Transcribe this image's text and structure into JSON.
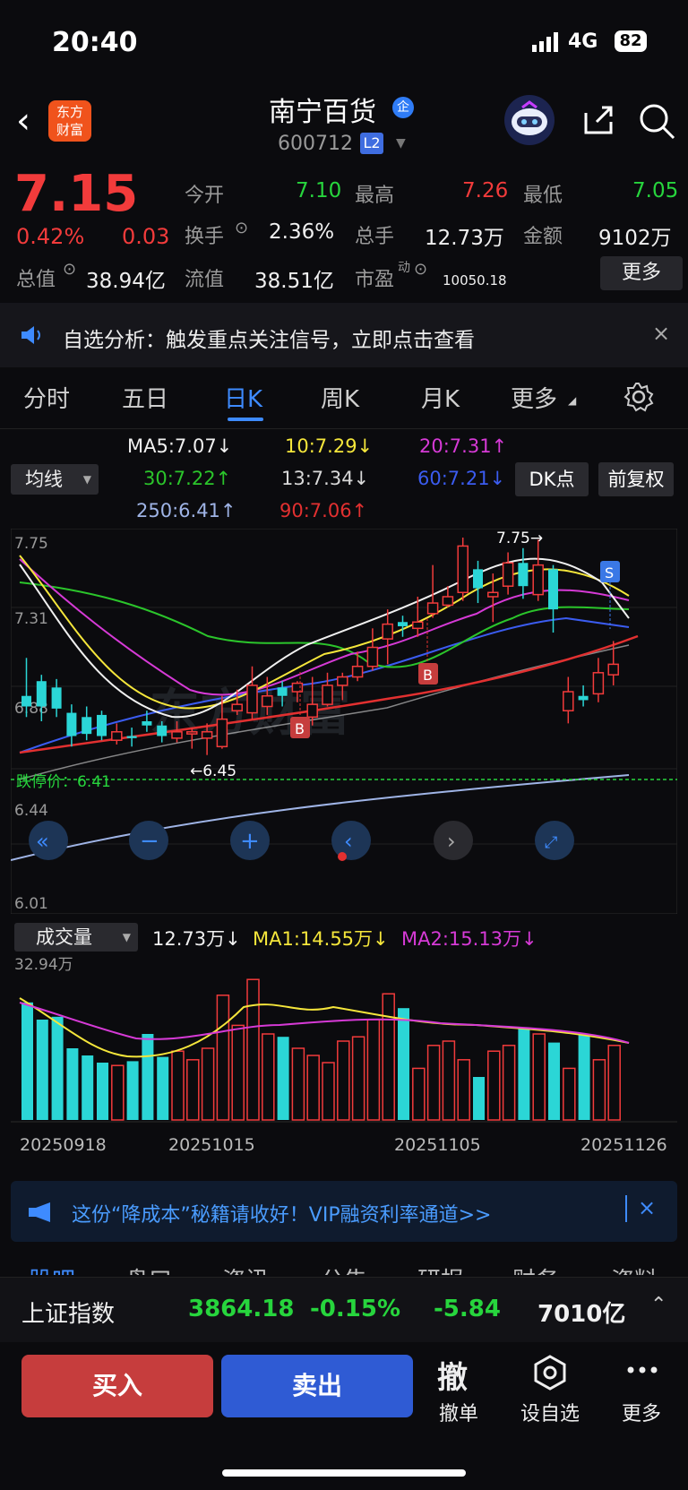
{
  "status_bar": {
    "time": "20:40",
    "network": "4G",
    "battery": "82"
  },
  "header": {
    "logo_line1": "东方",
    "logo_line2": "财富",
    "stock_name": "南宁百货",
    "name_badge": "企",
    "stock_code": "600712",
    "level_badge": "L2"
  },
  "quote": {
    "price": "7.15",
    "change_pct": "0.42%",
    "change_abs": "0.03",
    "open_label": "今开",
    "open": "7.10",
    "high_label": "最高",
    "high": "7.26",
    "low_label": "最低",
    "low": "7.05",
    "turnover_label": "换手",
    "turnover": "2.36%",
    "volume_label": "总手",
    "volume": "12.73万",
    "amount_label": "金额",
    "amount": "9102万",
    "mcap_label": "总值",
    "mcap": "38.94亿",
    "float_label": "流值",
    "float_mcap": "38.51亿",
    "pe_label": "市盈",
    "pe_sup": "动",
    "pe": "10050.18",
    "more_label": "更多"
  },
  "notice": {
    "text": "自选分析：触发重点关注信号，立即点击查看",
    "close": "×"
  },
  "tabs": [
    "分时",
    "五日",
    "日K",
    "周K",
    "月K",
    "更多"
  ],
  "ma_legend": {
    "selector": "均线",
    "ma5": "MA5:7.07↓",
    "ma10": "10:7.29↓",
    "ma20": "20:7.31↑",
    "ma30": "30:7.22↑",
    "ma13": "13:7.34↓",
    "ma60": "60:7.21↓",
    "ma250": "250:6.41↑",
    "ma90": "90:7.06↑",
    "dk_button": "DK点",
    "fq_button": "前复权"
  },
  "chart_labels": {
    "y_top": "7.75",
    "y_2": "7.31",
    "y_3": "6.88",
    "y_4": "6.44",
    "y_bottom": "6.01",
    "high_marker": "7.75→",
    "low_marker": "←6.45",
    "limit_down": "跌停价：6.41",
    "buy_marker": "B",
    "sell_marker": "S",
    "watermark": "东方财富"
  },
  "volume": {
    "selector": "成交量",
    "current": "12.73万↓",
    "ma1": "MA1:14.55万↓",
    "ma2": "MA2:15.13万↓",
    "y_max": "32.94万",
    "dates": [
      "20250918",
      "20251015",
      "20251105",
      "20251126"
    ]
  },
  "ad": {
    "text": "这份“降成本”秘籍请收好！VIP融资利率通道>>",
    "close": "×"
  },
  "cut_tabs": [
    "股吧",
    "盘口",
    "资讯",
    "公告",
    "研报",
    "财务",
    "资料"
  ],
  "index_bar": {
    "name": "上证指数",
    "value": "3864.18",
    "pct": "-0.15%",
    "change": "-5.84",
    "amount": "7010亿"
  },
  "actions": {
    "buy": "买入",
    "sell": "卖出",
    "cancel_icon": "撤",
    "cancel": "撤单",
    "watch": "设自选",
    "more": "更多"
  },
  "colors": {
    "up": "#f23b3b",
    "down": "#27d53d",
    "down_candle": "#2bd6d6",
    "accent": "#3e8bff"
  },
  "chart_data": {
    "type": "candlestick",
    "y_range": [
      6.01,
      7.75
    ],
    "candles": [
      [
        7.0,
        6.95,
        7.18,
        6.9
      ],
      [
        7.07,
        6.95,
        7.1,
        6.88
      ],
      [
        7.04,
        6.94,
        7.08,
        6.9
      ],
      [
        6.92,
        6.81,
        6.96,
        6.76
      ],
      [
        6.9,
        6.82,
        6.95,
        6.79
      ],
      [
        6.91,
        6.81,
        6.93,
        6.79
      ],
      [
        6.79,
        6.83,
        6.87,
        6.77
      ],
      [
        6.81,
        6.8,
        6.85,
        6.76
      ],
      [
        6.88,
        6.86,
        6.93,
        6.83
      ],
      [
        6.86,
        6.81,
        6.88,
        6.78
      ],
      [
        6.8,
        6.83,
        6.88,
        6.78
      ],
      [
        6.82,
        6.83,
        6.85,
        6.75
      ],
      [
        6.8,
        6.83,
        6.87,
        6.72
      ],
      [
        6.76,
        6.89,
        7.0,
        6.75
      ],
      [
        6.93,
        6.96,
        7.03,
        6.91
      ],
      [
        6.92,
        7.05,
        7.14,
        6.89
      ],
      [
        6.95,
        7.0,
        7.09,
        6.91
      ],
      [
        7.04,
        7.0,
        7.07,
        6.95
      ],
      [
        7.02,
        7.06,
        7.07,
        6.97
      ],
      [
        6.9,
        6.96,
        7.09,
        6.86
      ],
      [
        6.96,
        7.05,
        7.11,
        6.95
      ],
      [
        7.05,
        7.09,
        7.11,
        6.98
      ],
      [
        7.09,
        7.14,
        7.21,
        7.07
      ],
      [
        7.14,
        7.23,
        7.32,
        7.12
      ],
      [
        7.27,
        7.34,
        7.41,
        7.15
      ],
      [
        7.35,
        7.33,
        7.38,
        7.28
      ],
      [
        7.32,
        7.35,
        7.47,
        7.28
      ],
      [
        7.39,
        7.44,
        7.62,
        7.37
      ],
      [
        7.43,
        7.47,
        7.52,
        7.42
      ],
      [
        7.49,
        7.71,
        7.75,
        7.45
      ],
      [
        7.6,
        7.51,
        7.64,
        7.44
      ],
      [
        7.47,
        7.49,
        7.58,
        7.35
      ],
      [
        7.52,
        7.63,
        7.68,
        7.48
      ],
      [
        7.63,
        7.52,
        7.7,
        7.46
      ],
      [
        7.48,
        7.62,
        7.74,
        7.45
      ],
      [
        7.6,
        7.41,
        7.62,
        7.3
      ],
      [
        6.93,
        7.02,
        7.09,
        6.87
      ],
      [
        7.0,
        6.98,
        7.05,
        6.95
      ],
      [
        7.01,
        7.11,
        7.18,
        6.97
      ],
      [
        7.1,
        7.15,
        7.26,
        7.05
      ]
    ]
  }
}
